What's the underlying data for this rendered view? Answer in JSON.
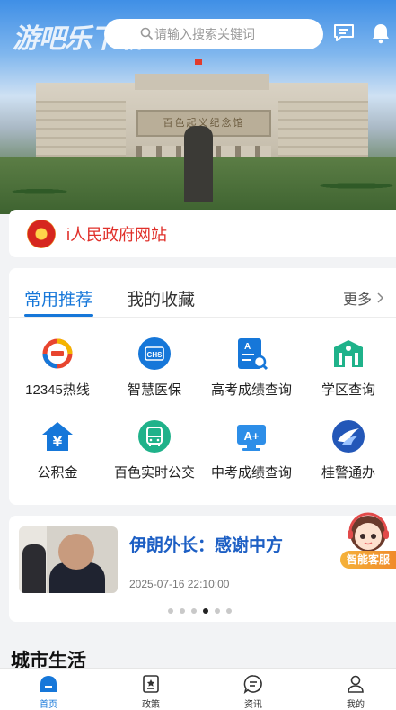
{
  "header": {
    "logo_text": "游吧乐下载",
    "search_placeholder": "请输入搜索关键词",
    "icons": [
      "message-icon",
      "bell-icon"
    ]
  },
  "hero": {
    "plaque_text": "百色起义纪念馆"
  },
  "notice": {
    "text": "i人民政府网站"
  },
  "services": {
    "tabs": [
      {
        "label": "常用推荐",
        "active": true
      },
      {
        "label": "我的收藏",
        "active": false
      }
    ],
    "more_label": "更多",
    "items": [
      {
        "label": "12345热线",
        "icon": "hotline-12345-icon",
        "color": "#e8452f"
      },
      {
        "label": "智慧医保",
        "icon": "medical-insurance-icon",
        "color": "#1677d9"
      },
      {
        "label": "高考成绩查询",
        "icon": "gaokao-score-icon",
        "color": "#1677d9"
      },
      {
        "label": "学区查询",
        "icon": "school-district-icon",
        "color": "#1fb28a"
      },
      {
        "label": "公积金",
        "icon": "housing-fund-icon",
        "color": "#1677d9"
      },
      {
        "label": "百色实时公交",
        "icon": "bus-icon",
        "color": "#1fb28a"
      },
      {
        "label": "中考成绩查询",
        "icon": "zhongkao-score-icon",
        "color": "#2d8ee8"
      },
      {
        "label": "桂警通办",
        "icon": "police-service-icon",
        "color": "#2357b8"
      }
    ]
  },
  "news": {
    "title": "伊朗外长：感谢中方",
    "time": "2025-07-16 22:10:00",
    "dots_total": 6,
    "dot_active": 3
  },
  "assistant": {
    "label": "智能客服"
  },
  "city_life": {
    "title": "城市生活"
  },
  "bottom_nav": [
    {
      "label": "首页",
      "icon": "home-icon",
      "active": true
    },
    {
      "label": "政策",
      "icon": "policy-icon",
      "active": false
    },
    {
      "label": "资讯",
      "icon": "news-icon",
      "active": false
    },
    {
      "label": "我的",
      "icon": "profile-icon",
      "active": false
    }
  ]
}
